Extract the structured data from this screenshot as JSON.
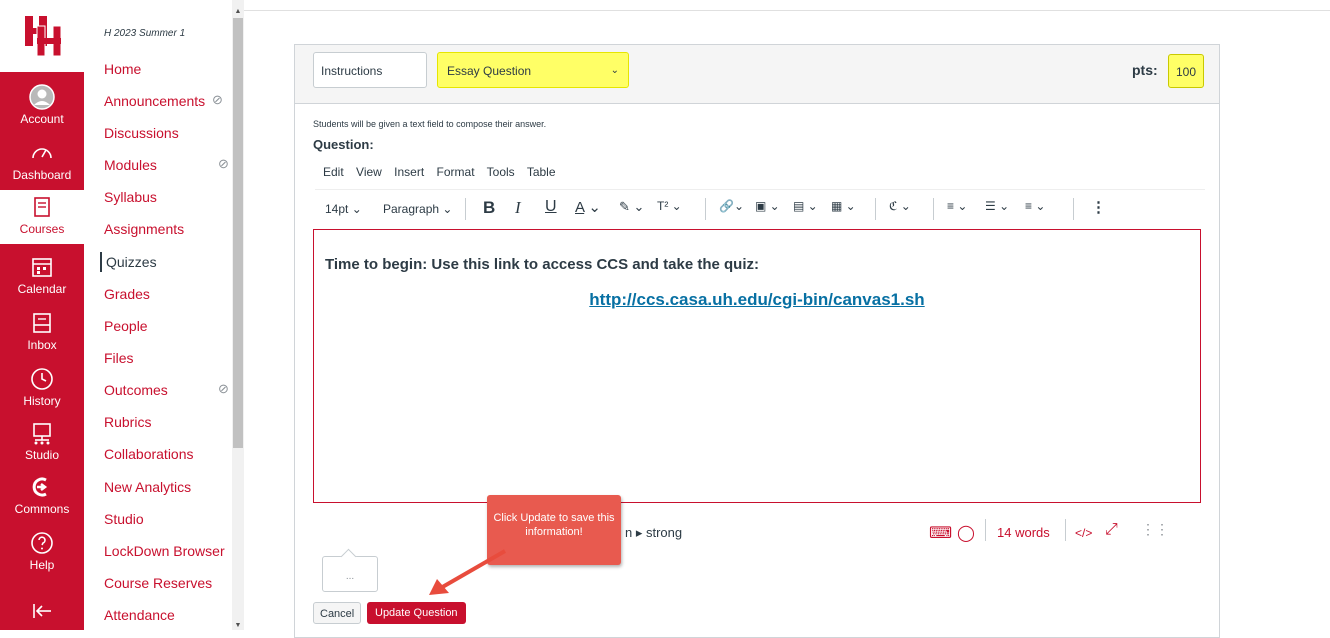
{
  "global_nav": {
    "items": [
      {
        "label": "Account",
        "icon": "avatar-icon"
      },
      {
        "label": "Dashboard",
        "icon": "dashboard-icon"
      },
      {
        "label": "Courses",
        "icon": "book-icon"
      },
      {
        "label": "Calendar",
        "icon": "calendar-icon"
      },
      {
        "label": "Inbox",
        "icon": "inbox-icon"
      },
      {
        "label": "History",
        "icon": "clock-icon"
      },
      {
        "label": "Studio",
        "icon": "studio-icon"
      },
      {
        "label": "Commons",
        "icon": "commons-icon"
      },
      {
        "label": "Help",
        "icon": "help-icon"
      }
    ],
    "collapse_icon": "collapse-arrow-icon",
    "brand_color": "#c8102e"
  },
  "course_nav": {
    "term": "H 2023 Summer 1",
    "items": [
      {
        "label": "Home"
      },
      {
        "label": "Announcements"
      },
      {
        "label": "Discussions"
      },
      {
        "label": "Modules"
      },
      {
        "label": "Syllabus"
      },
      {
        "label": "Assignments"
      },
      {
        "label": "Quizzes"
      },
      {
        "label": "Grades"
      },
      {
        "label": "People"
      },
      {
        "label": "Files"
      },
      {
        "label": "Outcomes"
      },
      {
        "label": "Rubrics"
      },
      {
        "label": "Collaborations"
      },
      {
        "label": "New Analytics"
      },
      {
        "label": "Studio"
      },
      {
        "label": "LockDown Browser"
      },
      {
        "label": "Course Reserves"
      },
      {
        "label": "Attendance"
      }
    ]
  },
  "question": {
    "name_value": "Instructions",
    "type_value": "Essay Question",
    "pts_label": "pts:",
    "pts_value": "100",
    "hint": "Students will be given a text field to compose their answer.",
    "label": "Question:"
  },
  "editor": {
    "menus": [
      "Edit",
      "View",
      "Insert",
      "Format",
      "Tools",
      "Table"
    ],
    "font_size": "14pt",
    "block_format": "Paragraph",
    "body_text": "Time to begin: Use this link to access CCS and take the quiz:",
    "body_link": "http://ccs.casa.uh.edu/cgi-bin/canvas1.sh",
    "path": "n ▸ strong",
    "word_count": "14 words",
    "html_toggle": "</>"
  },
  "callout": {
    "text": "Click Update to save this information!"
  },
  "bubble_text": "...",
  "buttons": {
    "cancel": "Cancel",
    "update": "Update Question"
  }
}
